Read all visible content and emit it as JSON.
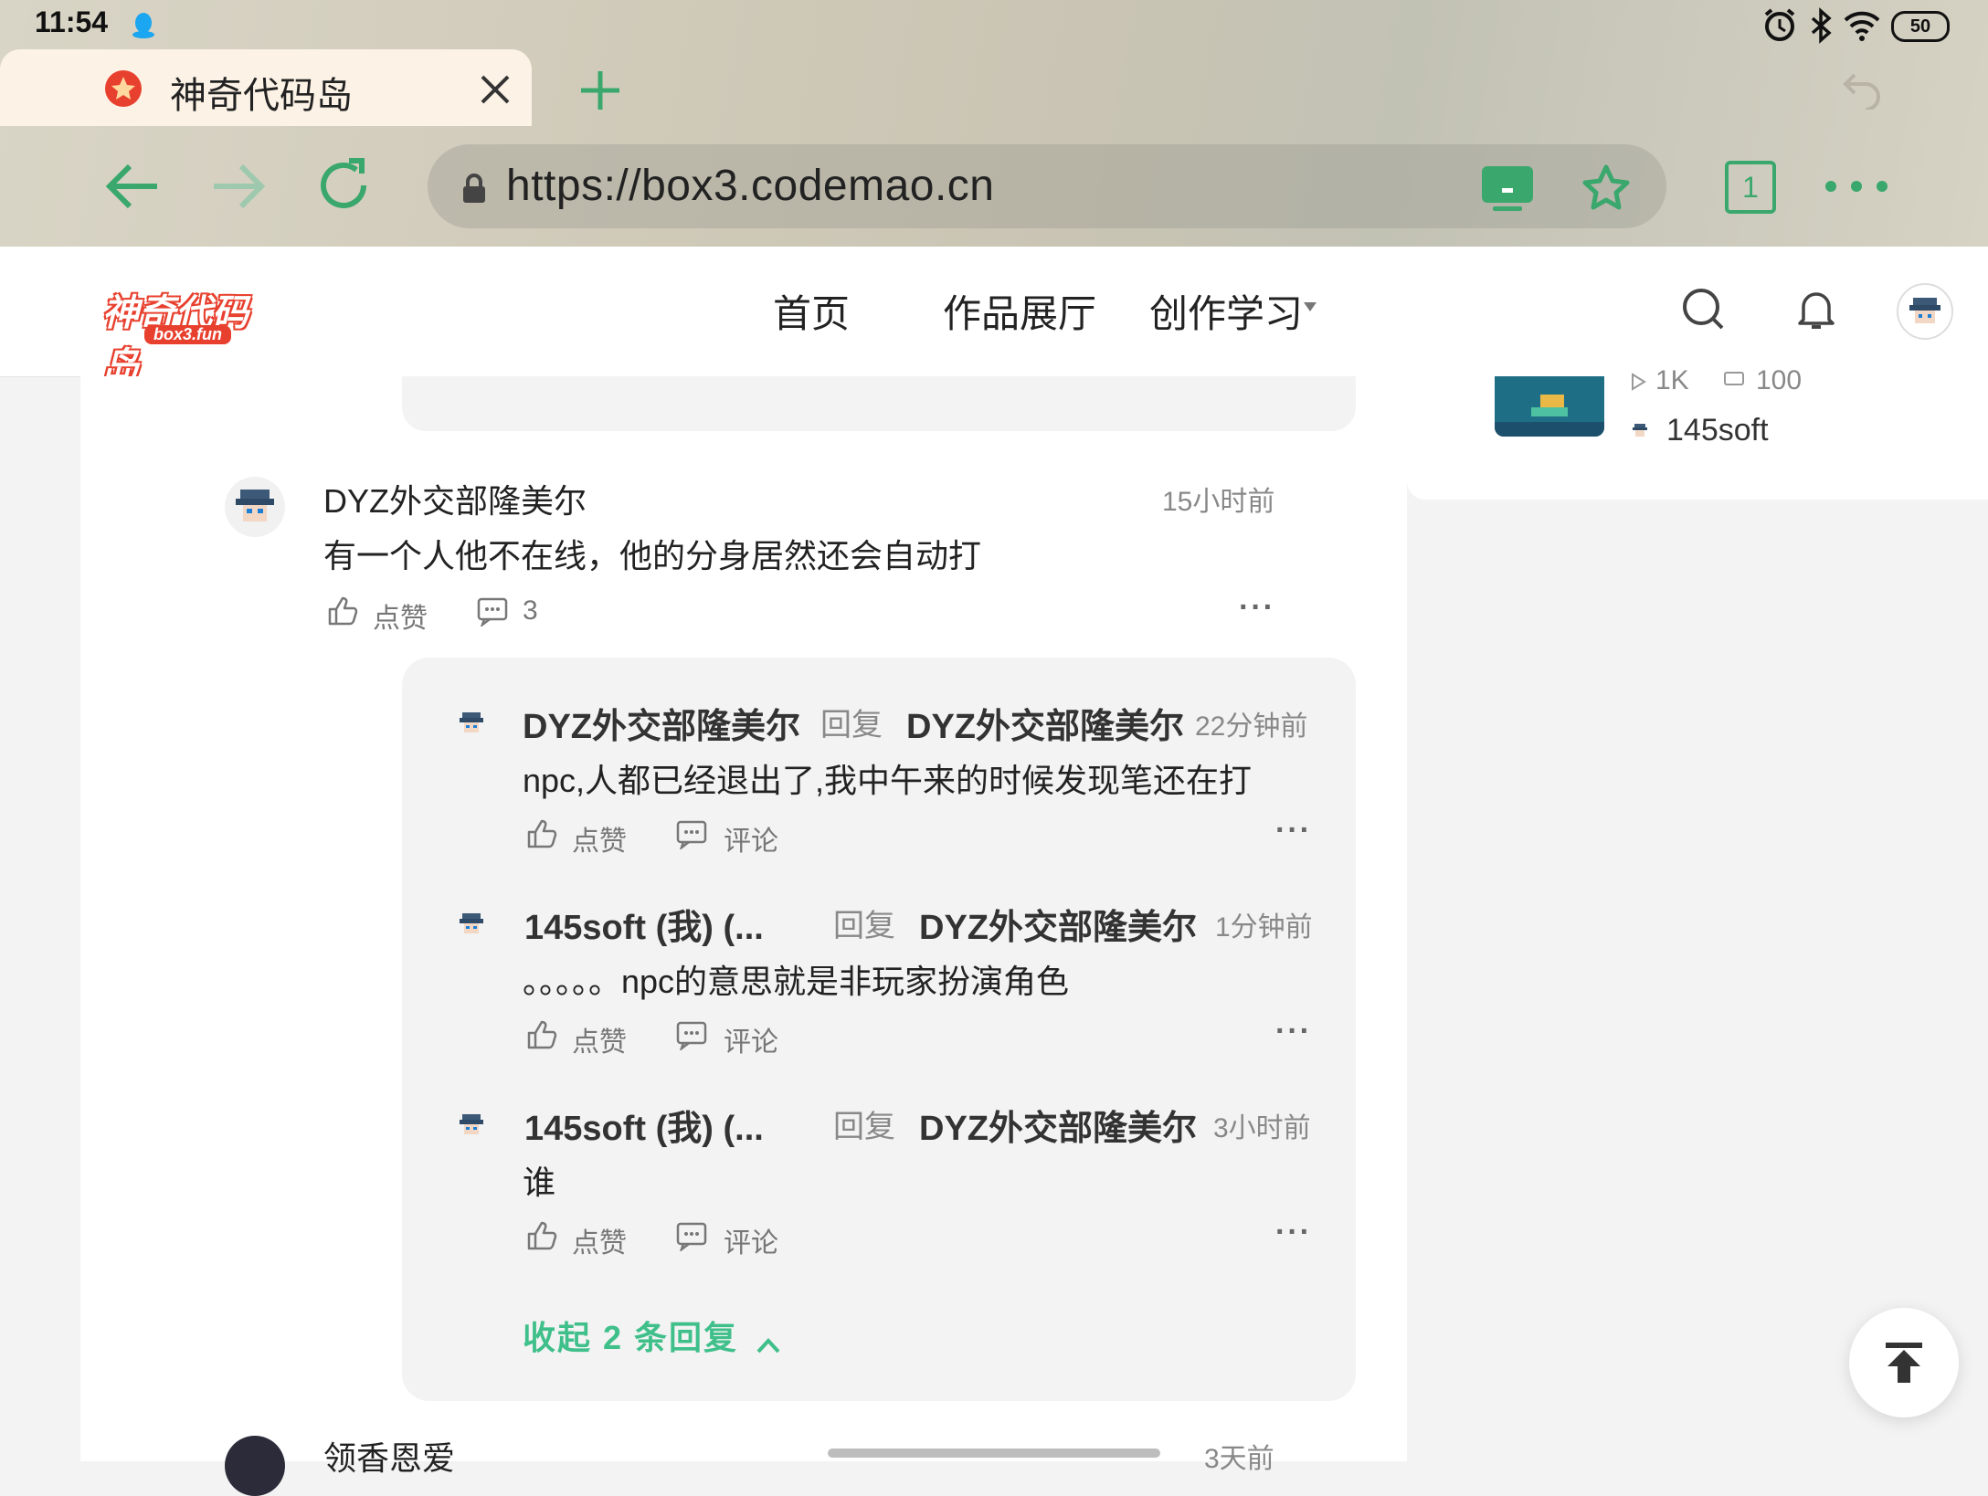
{
  "status": {
    "time": "11:54",
    "battery": "50"
  },
  "browser": {
    "tab_title": "神奇代码岛",
    "url": "https://box3.codemao.cn",
    "tab_count": "1"
  },
  "site": {
    "logo_text": "神奇代码岛",
    "logo_sub": "box3.fun",
    "nav": [
      "首页",
      "作品展厅",
      "创作学习"
    ]
  },
  "sidebar_card": {
    "views": "1K",
    "comments": "100",
    "author": "145soft"
  },
  "comment": {
    "author": "DYZ外交部隆美尔",
    "time": "15小时前",
    "text": "有一个人他不在线，他的分身居然还会自动打",
    "like_label": "点赞",
    "reply_count": "3"
  },
  "replies": [
    {
      "author": "DYZ外交部隆美尔",
      "reply_word": "回复",
      "target": "DYZ外交部隆美尔",
      "time": "22分钟前",
      "text": "npc,人都已经退出了,我中午来的时候发现笔还在打",
      "like_label": "点赞",
      "comment_label": "评论"
    },
    {
      "author": "145soft (我) (...",
      "reply_word": "回复",
      "target": "DYZ外交部隆美尔",
      "time": "1分钟前",
      "text": "。。。。。npc的意思就是非玩家扮演角色",
      "like_label": "点赞",
      "comment_label": "评论"
    },
    {
      "author": "145soft (我) (...",
      "reply_word": "回复",
      "target": "DYZ外交部隆美尔",
      "time": "3小时前",
      "text": "谁",
      "like_label": "点赞",
      "comment_label": "评论"
    }
  ],
  "collapse_label": "收起 2 条回复",
  "next_comment": {
    "author": "领香恩爱",
    "time": "3天前"
  },
  "colors": {
    "accent": "#3fbf8a",
    "chrome_green": "#3aa76d",
    "logo_red": "#e8402e"
  }
}
